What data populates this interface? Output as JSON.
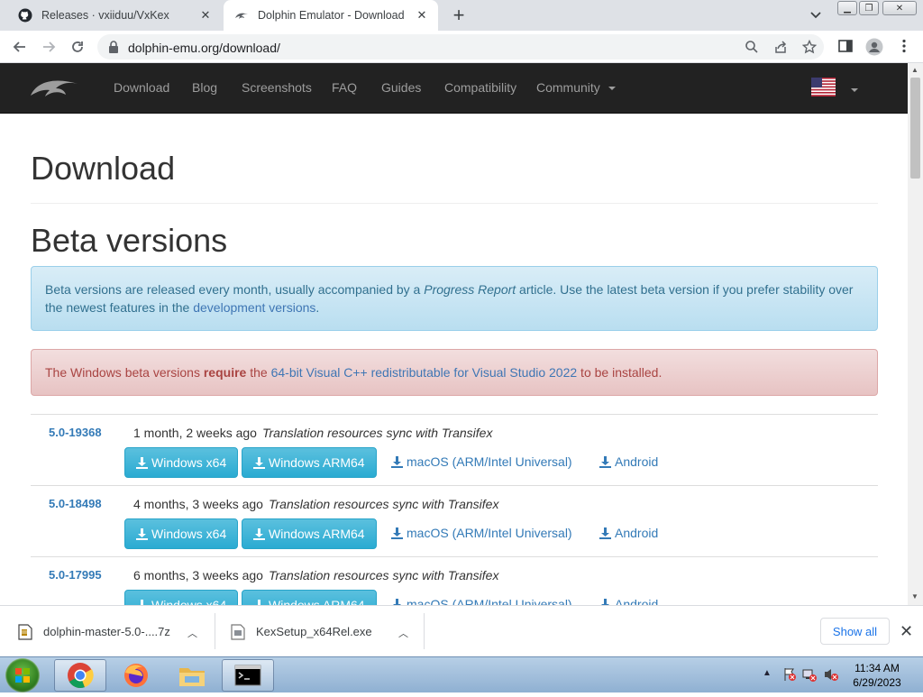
{
  "browser": {
    "tabs": [
      {
        "title": "Releases · vxiiduu/VxKex",
        "icon": "github-icon"
      },
      {
        "title": "Dolphin Emulator - Download",
        "icon": "dolphin-icon",
        "active": true
      }
    ],
    "url": "dolphin-emu.org/download/"
  },
  "site": {
    "nav": [
      "Download",
      "Blog",
      "Screenshots",
      "FAQ",
      "Guides",
      "Compatibility",
      "Community"
    ],
    "language_icon": "us-flag-icon"
  },
  "page": {
    "title": "Download",
    "section_title": "Beta versions",
    "info_alert": {
      "text_before": "Beta versions are released every month, usually accompanied by a ",
      "em": "Progress Report",
      "text_after": " article. Use the latest beta version if you prefer stability over the newest features in the ",
      "link": "development versions",
      "end": "."
    },
    "danger_alert": {
      "text_before": "The Windows beta versions ",
      "strong": "require",
      "text_mid": " the ",
      "link": "64-bit Visual C++ redistributable for Visual Studio 2022",
      "text_after": " to be installed."
    },
    "versions": [
      {
        "version": "5.0-19368",
        "age": "1 month, 2 weeks ago",
        "message": "Translation resources sync with Transifex"
      },
      {
        "version": "5.0-18498",
        "age": "4 months, 3 weeks ago",
        "message": "Translation resources sync with Transifex"
      },
      {
        "version": "5.0-17995",
        "age": "6 months, 3 weeks ago",
        "message": "Translation resources sync with Transifex"
      }
    ],
    "download_labels": {
      "win_x64": "Windows x64",
      "win_arm64": "Windows ARM64",
      "macos": "macOS (ARM/Intel Universal)",
      "android": "Android"
    }
  },
  "downloads_shelf": {
    "items": [
      "dolphin-master-5.0-....7z",
      "KexSetup_x64Rel.exe"
    ],
    "show_all": "Show all"
  },
  "taskbar": {
    "time": "11:34 AM",
    "date": "6/29/2023",
    "apps": [
      "chrome-icon",
      "firefox-icon",
      "file-explorer-icon",
      "command-prompt-icon"
    ]
  },
  "colors": {
    "navbar": "#222222",
    "info_bg": "#d9edf7",
    "danger_bg": "#f2dede",
    "button": "#2aabd2",
    "link": "#337ab7"
  }
}
